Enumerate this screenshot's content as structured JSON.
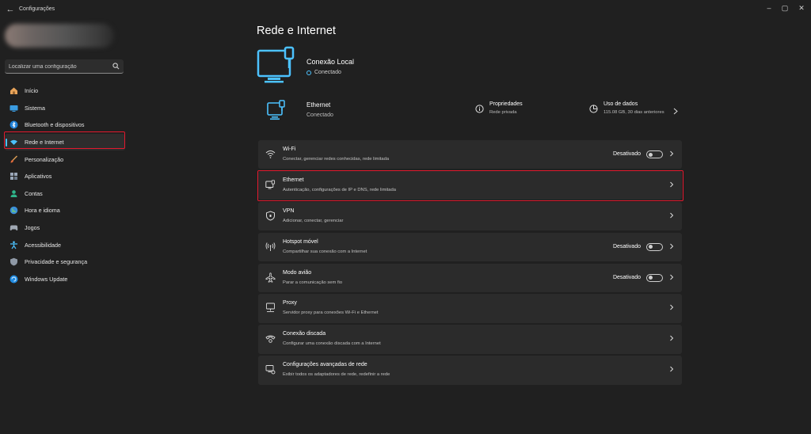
{
  "window": {
    "title": "Configurações"
  },
  "search": {
    "placeholder": "Localizar uma configuração"
  },
  "sidebar": {
    "items": [
      {
        "label": "Início",
        "icon": "home-icon"
      },
      {
        "label": "Sistema",
        "icon": "system-icon"
      },
      {
        "label": "Bluetooth e dispositivos",
        "icon": "bluetooth-icon"
      },
      {
        "label": "Rede e Internet",
        "icon": "network-icon",
        "active": true
      },
      {
        "label": "Personalização",
        "icon": "brush-icon"
      },
      {
        "label": "Aplicativos",
        "icon": "apps-icon"
      },
      {
        "label": "Contas",
        "icon": "account-icon"
      },
      {
        "label": "Hora e idioma",
        "icon": "globe-icon"
      },
      {
        "label": "Jogos",
        "icon": "gamepad-icon"
      },
      {
        "label": "Acessibilidade",
        "icon": "accessibility-icon"
      },
      {
        "label": "Privacidade e segurança",
        "icon": "shield-icon"
      },
      {
        "label": "Windows Update",
        "icon": "update-icon"
      }
    ]
  },
  "main": {
    "title": "Rede e Internet",
    "hero": {
      "name": "Conexão Local",
      "status": "Conectado"
    },
    "ethernet_summary": {
      "name": "Ethernet",
      "status": "Conectado",
      "properties_title": "Propriedades",
      "properties_subtitle": "Rede privada",
      "data_usage_title": "Uso de dados",
      "data_usage_subtitle": "115.08 GB, 30 dias anteriores"
    },
    "cards": [
      {
        "title": "Wi-Fi",
        "subtitle": "Conectar, gerenciar redes conhecidas, rede limitada",
        "state": "Desativado",
        "icon": "wifi-icon"
      },
      {
        "title": "Ethernet",
        "subtitle": "Autenticação, configurações de IP e DNS, rede limitada",
        "icon": "ethernet-icon"
      },
      {
        "title": "VPN",
        "subtitle": "Adicionar, conectar, gerenciar",
        "icon": "vpn-shield-icon"
      },
      {
        "title": "Hotspot móvel",
        "subtitle": "Compartilhar sua conexão com a Internet",
        "state": "Desativado",
        "icon": "hotspot-icon"
      },
      {
        "title": "Modo avião",
        "subtitle": "Parar a comunicação sem fio",
        "state": "Desativado",
        "icon": "airplane-icon"
      },
      {
        "title": "Proxy",
        "subtitle": "Servidor proxy para conexões Wi-Fi e Ethernet",
        "icon": "proxy-icon"
      },
      {
        "title": "Conexão discada",
        "subtitle": "Configurar uma conexão discada com a Internet",
        "icon": "dialup-icon"
      },
      {
        "title": "Configurações avançadas de rede",
        "subtitle": "Exibir todos os adaptadores de rede, redefinir a rede",
        "icon": "advanced-network-icon"
      }
    ]
  },
  "colors": {
    "accent": "#4cc2ff",
    "highlight": "#e3192e",
    "background": "#202020",
    "card": "#2b2b2b"
  }
}
